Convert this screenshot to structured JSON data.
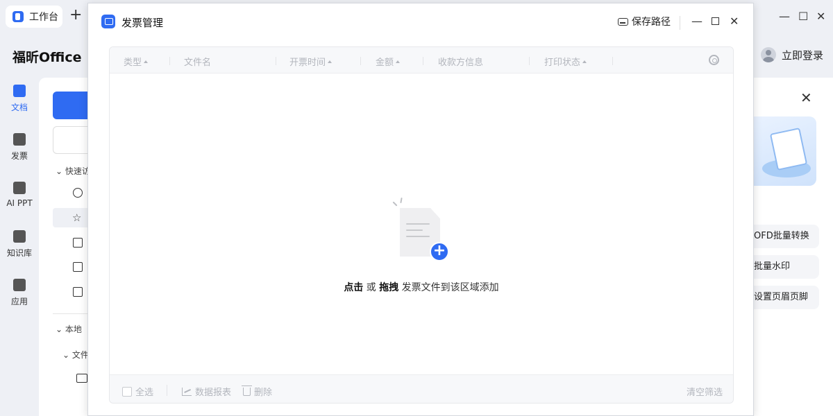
{
  "app": {
    "tab_label": "工作台",
    "brand": "福昕Office",
    "login_label": "立即登录",
    "nav": [
      {
        "label": "文档",
        "icon": "document-icon"
      },
      {
        "label": "发票",
        "icon": "invoice-icon"
      },
      {
        "label": "AI PPT",
        "icon": "ai-ppt-icon"
      },
      {
        "label": "知识库",
        "icon": "knowledge-base-icon"
      },
      {
        "label": "应用",
        "icon": "apps-icon"
      }
    ],
    "tree": {
      "quick_access": "快速访",
      "local": "本地",
      "folder": "文件"
    },
    "tools": [
      "OFD批量转换",
      "批量水印",
      "设置页眉页脚"
    ]
  },
  "modal": {
    "title": "发票管理",
    "save_path_label": "保存路径",
    "columns": [
      {
        "label": "类型",
        "sortable": true
      },
      {
        "label": "文件名",
        "sortable": false
      },
      {
        "label": "开票时间",
        "sortable": true
      },
      {
        "label": "金额",
        "sortable": true
      },
      {
        "label": "收款方信息",
        "sortable": false
      },
      {
        "label": "打印状态",
        "sortable": true
      }
    ],
    "empty": {
      "click": "点击",
      "or": " 或 ",
      "drag": "拖拽",
      "rest": " 发票文件到该区域添加"
    },
    "footer": {
      "select_all": "全选",
      "data_report": "数据报表",
      "delete": "删除",
      "clear_filter": "清空筛选"
    }
  },
  "colors": {
    "accent": "#2f6bf2",
    "disabled_text": "#b3b6bd"
  }
}
